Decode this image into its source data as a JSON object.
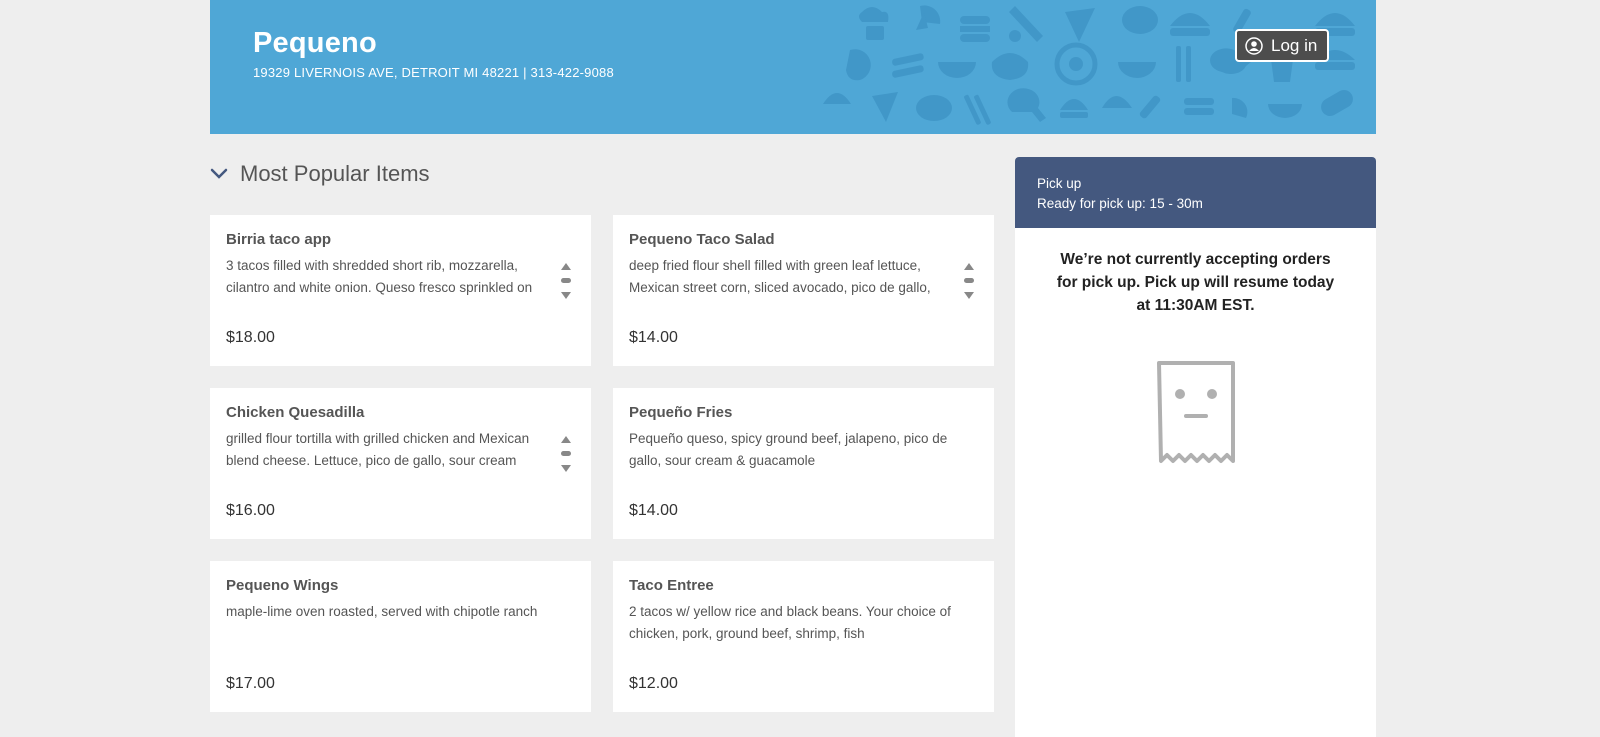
{
  "restaurant": {
    "name": "Pequeno",
    "address_line": "19329 LIVERNOIS AVE, DETROIT MI 48221 | 313-422-9088"
  },
  "header": {
    "login_label": "Log in",
    "accent_color": "#4fa7d6"
  },
  "section": {
    "title": "Most Popular Items"
  },
  "items": [
    {
      "name": "Birria taco app",
      "description": "3 tacos filled with shredded short rib, mozzarella, cilantro and white onion. Queso fresco sprinkled on",
      "price": "$18.00"
    },
    {
      "name": "Pequeno Taco Salad",
      "description": "deep fried flour shell filled with green leaf lettuce, Mexican street corn,  sliced avocado, pico de gallo,",
      "price": "$14.00"
    },
    {
      "name": "Chicken Quesadilla",
      "description": "grilled flour tortilla with grilled chicken and Mexican blend cheese. Lettuce, pico de gallo, sour cream",
      "price": "$16.00"
    },
    {
      "name": "Pequeño Fries",
      "description": "Pequeño queso, spicy ground beef, jalapeno, pico de gallo, sour cream & guacamole",
      "price": "$14.00"
    },
    {
      "name": "Pequeno Wings",
      "description": "maple-lime oven roasted, served with chipotle ranch",
      "price": "$17.00"
    },
    {
      "name": "Taco Entree",
      "description": "2 tacos w/ yellow rice and black beans. Your choice of chicken, pork, ground beef, shrimp, fish",
      "price": "$12.00"
    }
  ],
  "order_panel": {
    "mode": "Pick up",
    "ready_time": "Ready for pick up: 15 - 30m",
    "message": "We’re not currently accepting orders for pick up. Pick up will resume today at 11:30AM EST.",
    "header_color": "#44587f"
  }
}
